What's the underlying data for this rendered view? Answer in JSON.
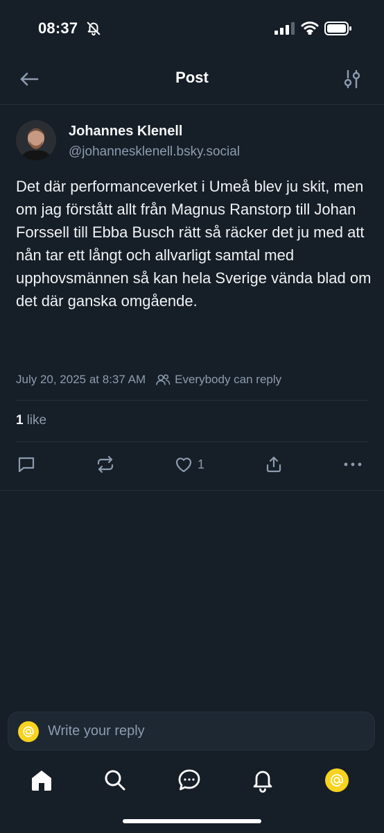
{
  "status_bar": {
    "time": "08:37"
  },
  "header": {
    "title": "Post"
  },
  "post": {
    "author": {
      "name": "Johannes Klenell",
      "handle": "@johannesklenell.bsky.social"
    },
    "text": "Det där performanceverket i Umeå blev ju skit, men om jag förstått allt från Magnus Ranstorp till Johan Forssell till Ebba Busch rätt så räcker det ju med att nån tar ett långt och allvarligt samtal med upphovsmännen så kan hela Sverige vända blad om det där ganska omgående.",
    "timestamp": "July 20, 2025 at 8:37 AM",
    "reply_setting": "Everybody can reply",
    "likes": {
      "count": "1",
      "label": "like"
    },
    "actions": {
      "reply_icon": "comment-icon",
      "repost_icon": "repost-icon",
      "like_icon": "heart-icon",
      "like_count": "1",
      "share_icon": "share-icon",
      "more_icon": "more-icon"
    }
  },
  "reply_bar": {
    "placeholder": "Write your reply"
  },
  "tab_bar": {
    "items": [
      "home-icon",
      "search-icon",
      "chat-icon",
      "notifications-icon",
      "profile-avatar"
    ]
  },
  "colors": {
    "background": "#161e27",
    "text_primary": "#f1f3f5",
    "text_muted": "#8d9cb0",
    "divider": "#26313d",
    "avatar_accent": "#f7d31e"
  }
}
